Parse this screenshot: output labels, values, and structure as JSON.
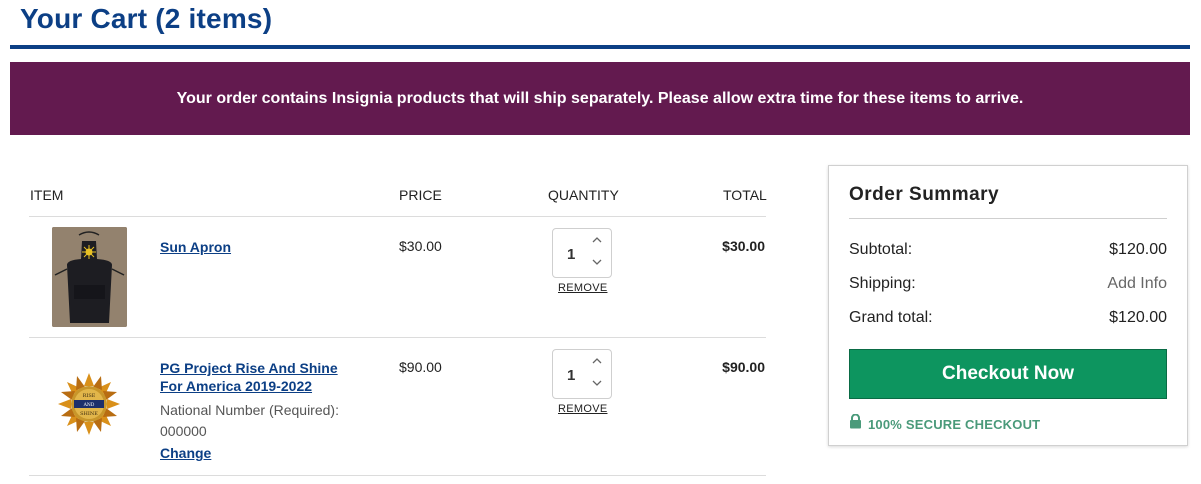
{
  "page": {
    "title": "Your Cart (2 items)"
  },
  "banner": {
    "text": "Your order contains Insignia products that will ship separately. Please allow extra time for these items to arrive."
  },
  "cart": {
    "headers": {
      "item": "ITEM",
      "price": "PRICE",
      "quantity": "QUANTITY",
      "total": "TOTAL"
    },
    "items": [
      {
        "name": "Sun Apron",
        "price": "$30.00",
        "quantity": "1",
        "total": "$30.00",
        "remove_label": "REMOVE"
      },
      {
        "name": "PG Project Rise And Shine For America 2019-2022",
        "price": "$90.00",
        "quantity": "1",
        "total": "$90.00",
        "remove_label": "REMOVE",
        "option_label": "National Number (Required):",
        "option_value": "000000",
        "change_label": "Change"
      }
    ]
  },
  "summary": {
    "title": "Order Summary",
    "subtotal_label": "Subtotal:",
    "subtotal_value": "$120.00",
    "shipping_label": "Shipping:",
    "shipping_value": "Add Info",
    "grand_total_label": "Grand total:",
    "grand_total_value": "$120.00",
    "checkout_label": "Checkout Now",
    "secure_label": "100% SECURE CHECKOUT"
  },
  "colors": {
    "brand_blue": "#0c3f85",
    "banner_purple": "#631a4f",
    "checkout_green": "#0d955f",
    "secure_green": "#4a9a7a"
  },
  "icons": [
    "chevron-up-icon",
    "chevron-down-icon",
    "lock-icon"
  ]
}
